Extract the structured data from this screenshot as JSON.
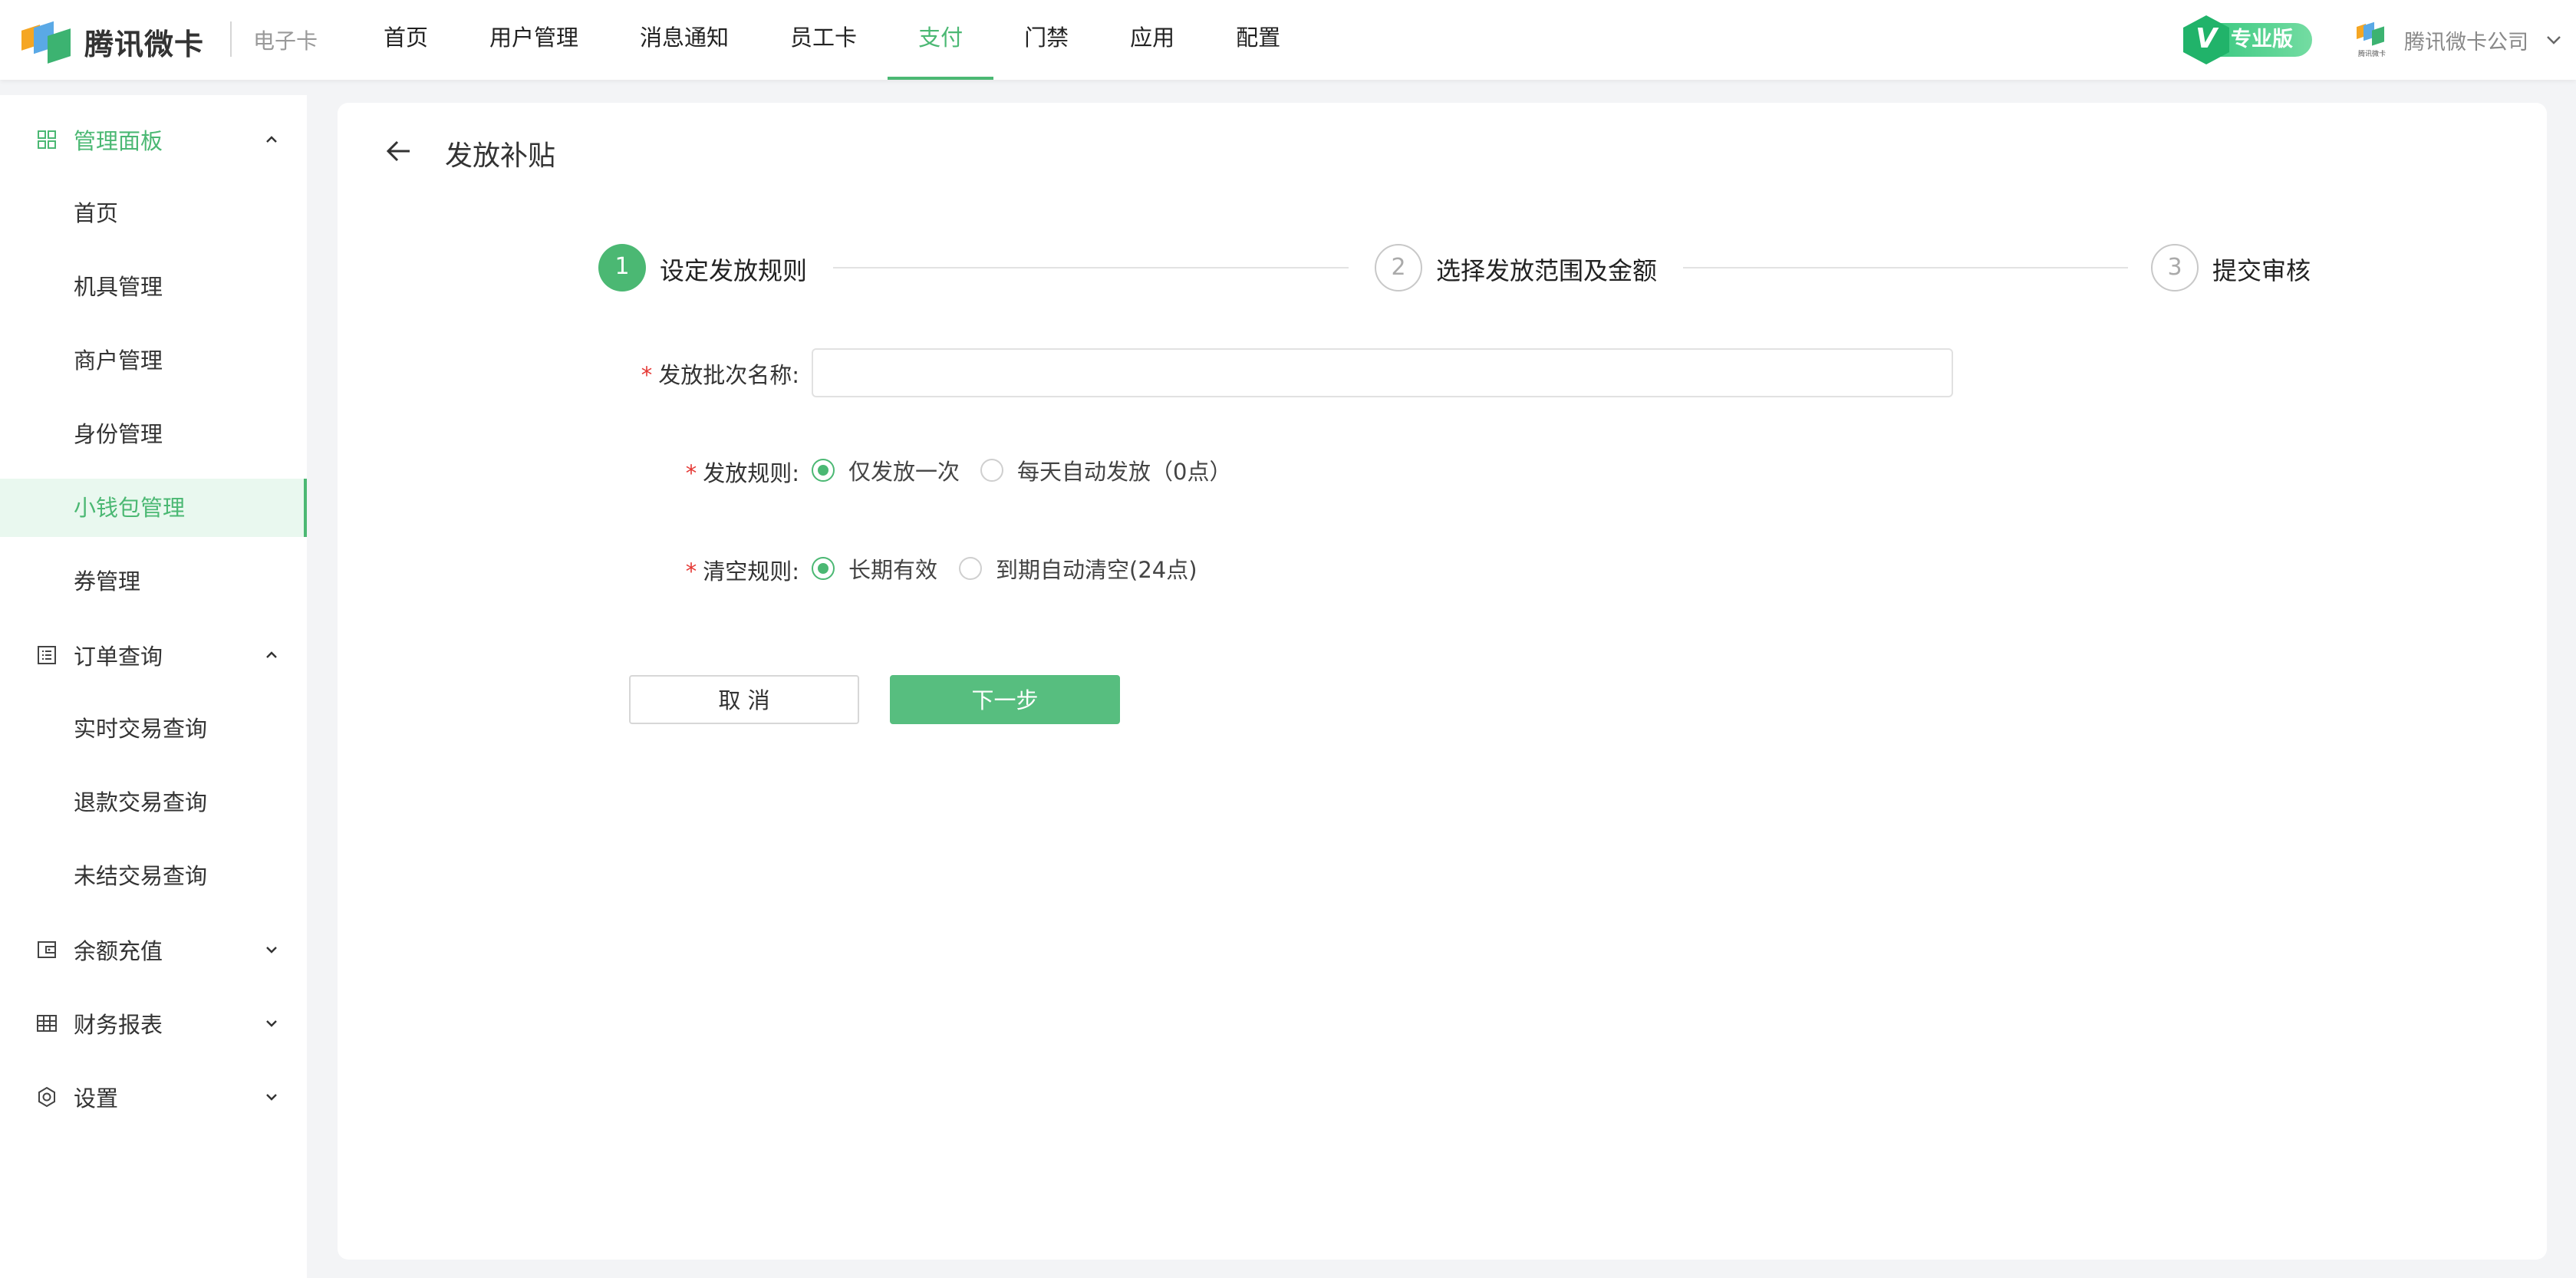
{
  "header": {
    "brand": "腾讯微卡",
    "sub_brand": "电子卡",
    "nav": [
      {
        "label": "首页",
        "active": false
      },
      {
        "label": "用户管理",
        "active": false
      },
      {
        "label": "消息通知",
        "active": false
      },
      {
        "label": "员工卡",
        "active": false
      },
      {
        "label": "支付",
        "active": true
      },
      {
        "label": "门禁",
        "active": false
      },
      {
        "label": "应用",
        "active": false
      },
      {
        "label": "配置",
        "active": false
      }
    ],
    "badge_letter": "V",
    "badge_text": "专业版",
    "company_logo_caption": "腾讯微卡",
    "company_name": "腾讯微卡公司"
  },
  "sidebar": {
    "groups": [
      {
        "label": "管理面板",
        "icon": "dashboard-icon",
        "expanded": true,
        "items": [
          {
            "label": "首页",
            "active": false
          },
          {
            "label": "机具管理",
            "active": false
          },
          {
            "label": "商户管理",
            "active": false
          },
          {
            "label": "身份管理",
            "active": false
          },
          {
            "label": "小钱包管理",
            "active": true
          },
          {
            "label": "券管理",
            "active": false
          }
        ]
      },
      {
        "label": "订单查询",
        "icon": "order-list-icon",
        "expanded": true,
        "items": [
          {
            "label": "实时交易查询",
            "active": false
          },
          {
            "label": "退款交易查询",
            "active": false
          },
          {
            "label": "未结交易查询",
            "active": false
          }
        ]
      },
      {
        "label": "余额充值",
        "icon": "wallet-icon",
        "expanded": false,
        "items": []
      },
      {
        "label": "财务报表",
        "icon": "table-icon",
        "expanded": false,
        "items": []
      },
      {
        "label": "设置",
        "icon": "gear-icon",
        "expanded": false,
        "items": []
      }
    ]
  },
  "page": {
    "title": "发放补贴",
    "steps": [
      {
        "number": "1",
        "label": "设定发放规则",
        "status": "current"
      },
      {
        "number": "2",
        "label": "选择发放范围及金额",
        "status": "pending"
      },
      {
        "number": "3",
        "label": "提交审核",
        "status": "pending"
      }
    ],
    "form": {
      "required_mark": "*",
      "batch_name_label": "发放批次名称:",
      "batch_name_value": "",
      "rule_label": "发放规则:",
      "rule_options": [
        {
          "label": "仅发放一次",
          "checked": true
        },
        {
          "label": "每天自动发放（0点）",
          "checked": false
        }
      ],
      "clear_label": "清空规则:",
      "clear_options": [
        {
          "label": "长期有效",
          "checked": true
        },
        {
          "label": "到期自动清空(24点)",
          "checked": false
        }
      ]
    },
    "buttons": {
      "cancel": "取 消",
      "next": "下一步"
    }
  },
  "colors": {
    "accent": "#4bb873",
    "required": "#e53935",
    "active_bg": "#e9f8ef"
  }
}
